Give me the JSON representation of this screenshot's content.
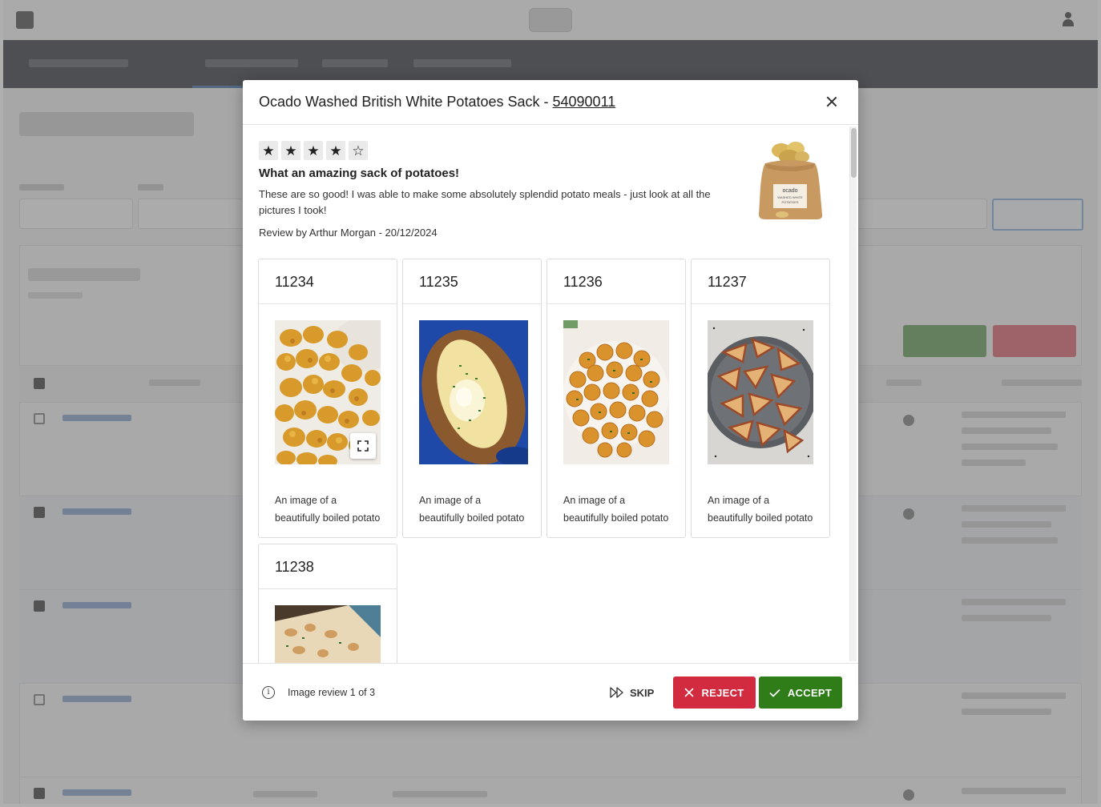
{
  "modal": {
    "title_prefix": "Ocado Washed British White Potatoes Sack - ",
    "product_id": "54090011"
  },
  "review": {
    "rating": 4,
    "max_rating": 5,
    "title": "What an amazing sack of potatoes!",
    "body": "These are so good! I was able to make some absolutely splendid potato meals - just look at all the pictures I took!",
    "byline": "Review by Arthur Morgan - 20/12/2024"
  },
  "product_image": {
    "brand": "ocado",
    "line1": "WASHED WHITE",
    "line2": "POTATOES"
  },
  "images": [
    {
      "id": "11234",
      "caption": "An image of a beautifully boiled potato",
      "icon": "roasted-potatoes-image"
    },
    {
      "id": "11235",
      "caption": "An image of a beautifully boiled potato",
      "icon": "baked-potato-image"
    },
    {
      "id": "11236",
      "caption": "An image of a beautifully boiled potato",
      "icon": "potato-rounds-image"
    },
    {
      "id": "11237",
      "caption": "An image of a beautifully boiled potato",
      "icon": "potato-wedges-image"
    },
    {
      "id": "11238",
      "caption": "",
      "icon": "potato-gratin-image"
    }
  ],
  "footer": {
    "status": "Image review 1 of 3",
    "skip_label": "SKIP",
    "reject_label": "REJECT",
    "accept_label": "ACCEPT"
  },
  "colors": {
    "reject": "#d22a3f",
    "accept": "#2e7d18",
    "navbar": "#262b31"
  }
}
